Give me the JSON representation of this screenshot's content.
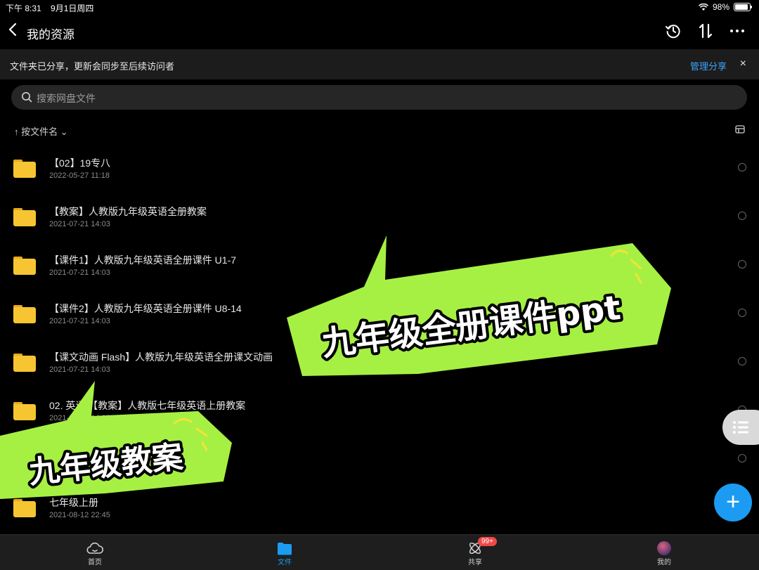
{
  "status_bar": {
    "time": "下午 8:31",
    "date": "9月1日周四",
    "battery": "98%",
    "battery_level": 0.98
  },
  "header": {
    "title": "我的资源"
  },
  "banner": {
    "text": "文件夹已分享，更新会同步至后续访问者",
    "link": "管理分享",
    "close": "×"
  },
  "search": {
    "placeholder": "搜索网盘文件"
  },
  "sort": {
    "label": "↑ 按文件名 ⌄"
  },
  "files": [
    {
      "name": "【02】19专八",
      "date": "2022-05-27 11:18"
    },
    {
      "name": "【教案】人教版九年级英语全册教案",
      "date": "2021-07-21 14:03"
    },
    {
      "name": "【课件1】人教版九年级英语全册课件 U1-7",
      "date": "2021-07-21 14:03"
    },
    {
      "name": "【课件2】人教版九年级英语全册课件 U8-14",
      "date": "2021-07-21 14:03"
    },
    {
      "name": "【课文动画 Flash】人教版九年级英语全册课文动画",
      "date": "2021-07-21 14:03"
    },
    {
      "name": "02. 英语 【教案】人教版七年级英语上册教案",
      "date": "2021-07-21 14:03"
    },
    {
      "name": "",
      "date": ""
    },
    {
      "name": "七年级上册",
      "date": "2021-08-12 22:45"
    }
  ],
  "callouts": {
    "ppt": "九年级全册课件ppt",
    "lesson_plan": "九年级教案"
  },
  "fab": {
    "add": "+"
  },
  "tabbar": {
    "items": [
      {
        "label": "首页"
      },
      {
        "label": "文件"
      },
      {
        "label": "共享",
        "badge": "99+"
      },
      {
        "label": "我的"
      }
    ]
  },
  "colors": {
    "accent": "#1b9cf2",
    "callout": "#a6f043",
    "folder": "#f7c531"
  }
}
